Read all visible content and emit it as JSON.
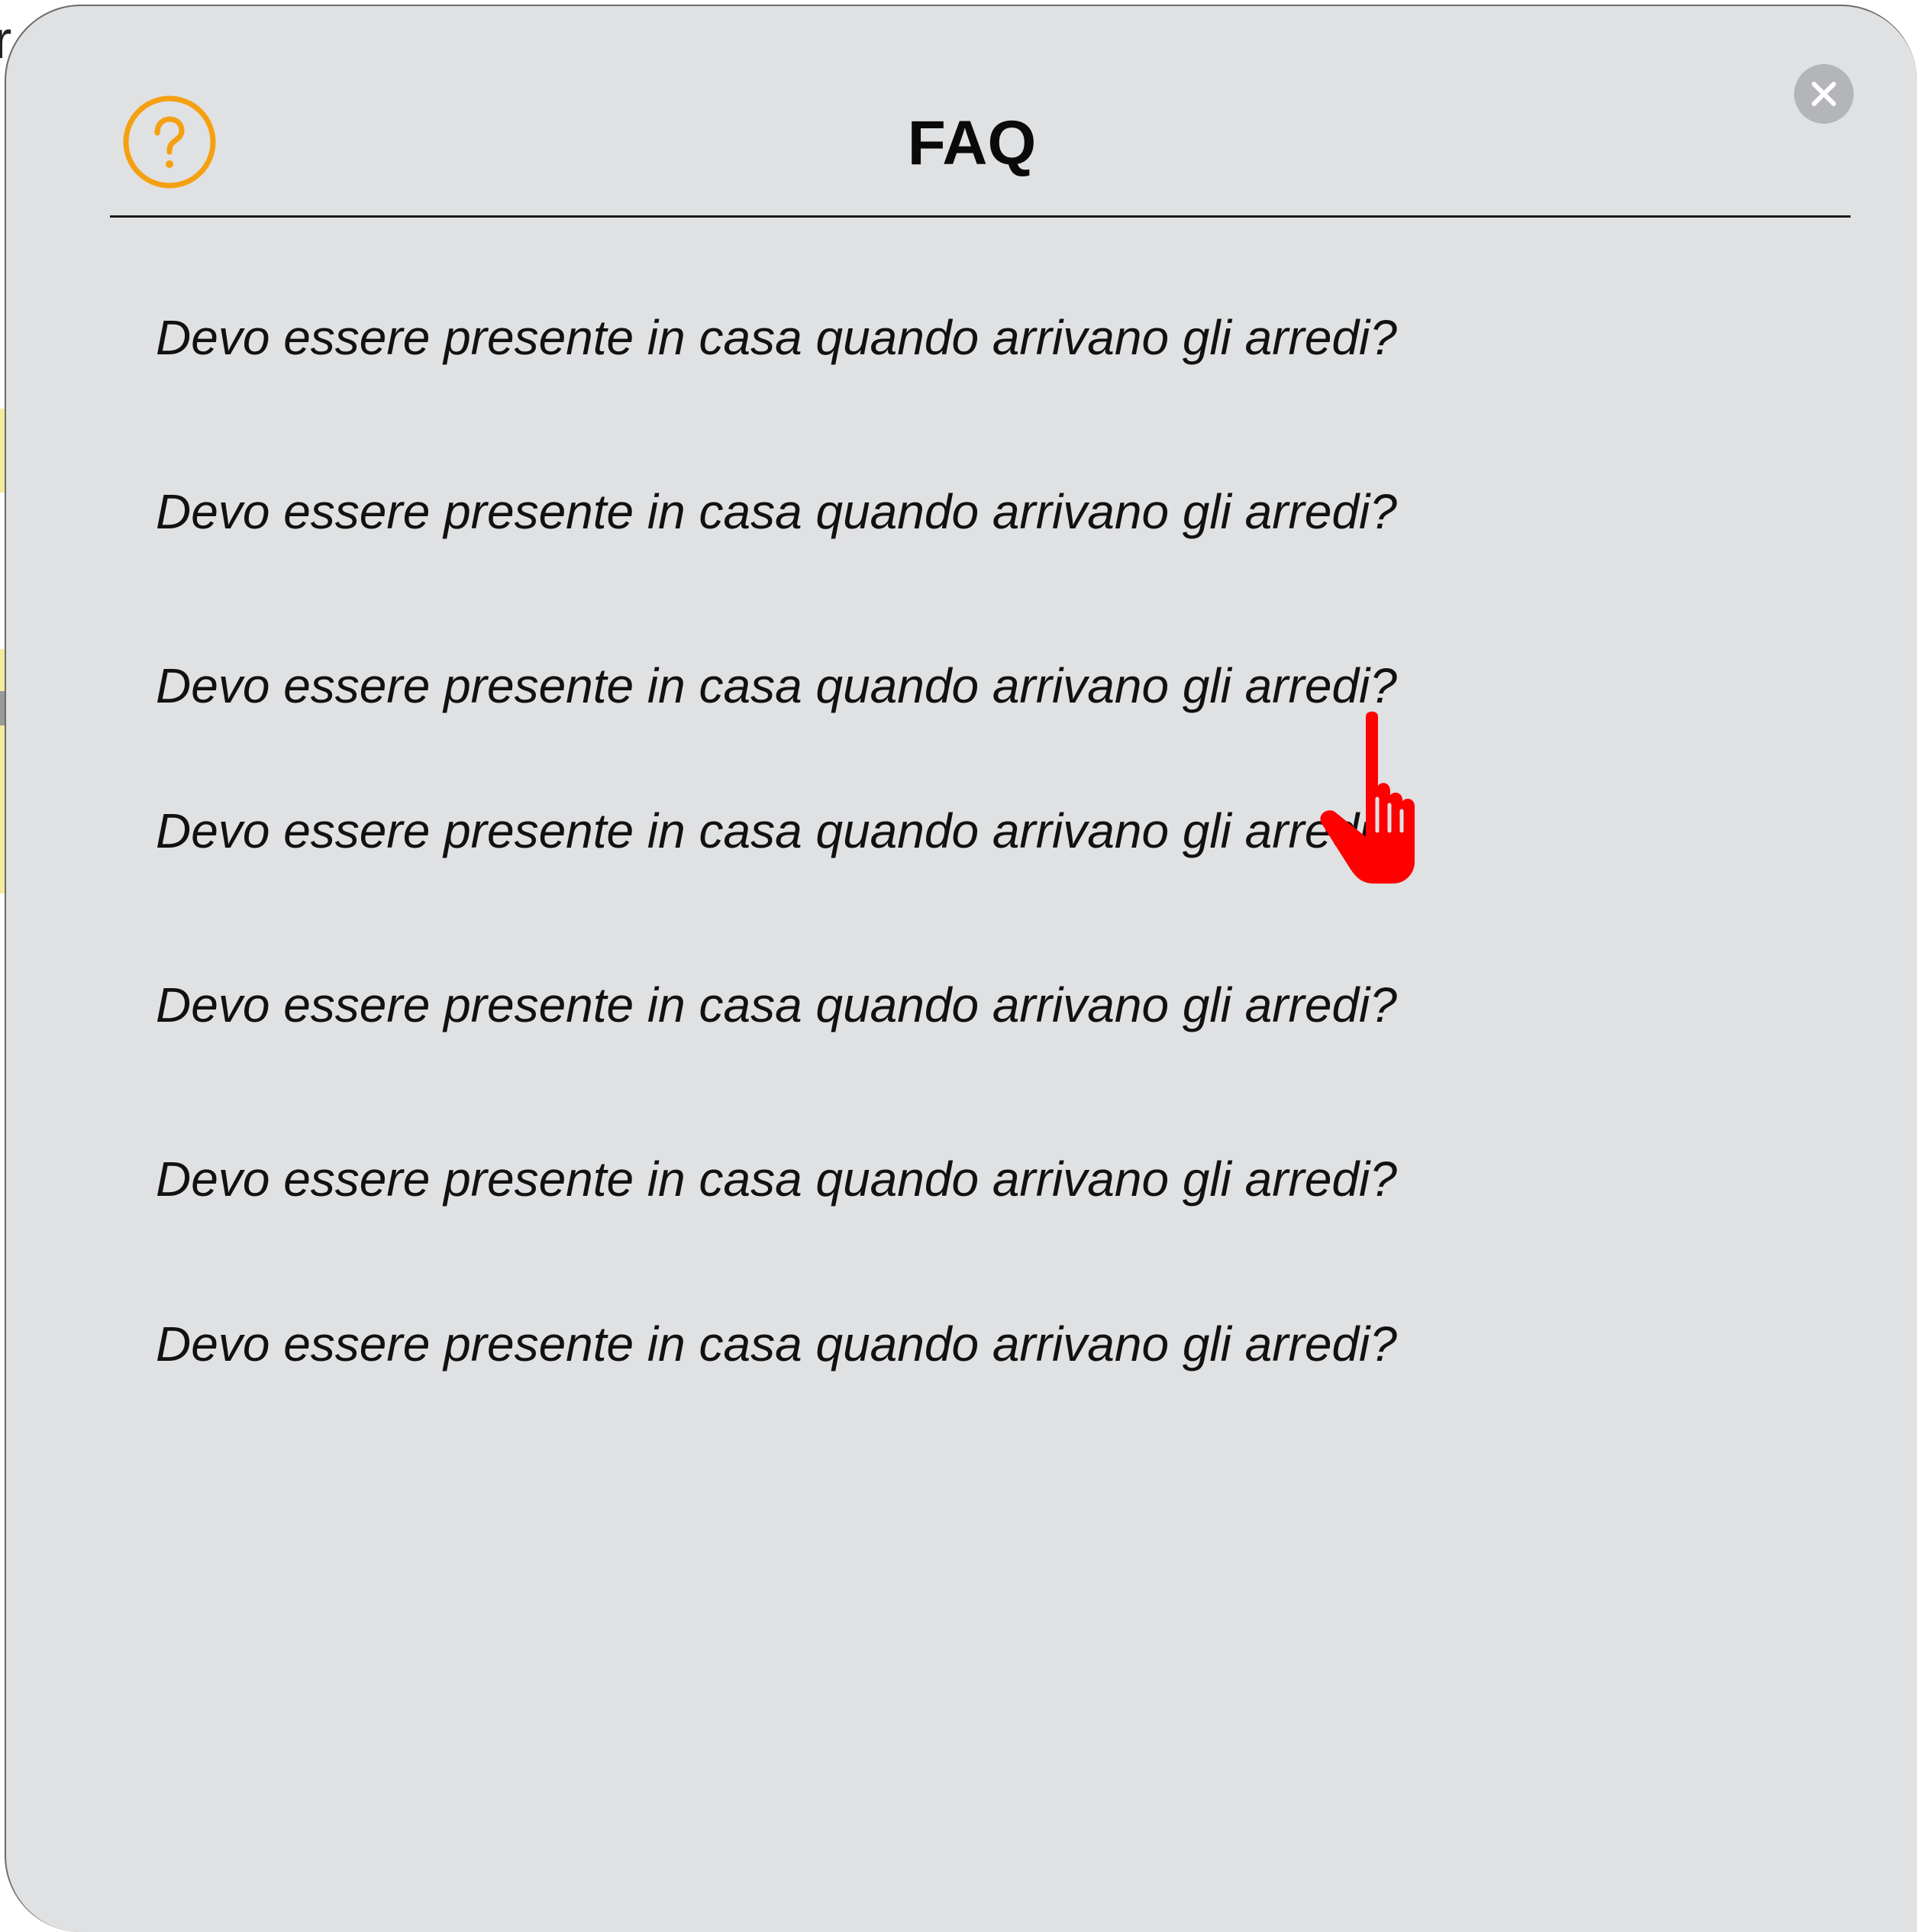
{
  "modal": {
    "title": "FAQ",
    "help_icon": "question-circle-icon",
    "close_icon": "close-icon",
    "accent_color": "#f5a011",
    "background_color": "#e0e1e3"
  },
  "faq": {
    "items": [
      {
        "question": "Devo essere presente in casa quando arrivano gli arredi?"
      },
      {
        "question": "Devo essere presente in casa quando arrivano gli arredi?"
      },
      {
        "question": "Devo essere presente in casa quando arrivano gli arredi?"
      },
      {
        "question": "Devo essere presente in casa quando arrivano gli arredi?"
      },
      {
        "question": "Devo essere presente in casa quando arrivano gli arredi?"
      },
      {
        "question": "Devo essere presente in casa quando arrivano gli arredi?"
      },
      {
        "question": "Devo essere presente in casa quando arrivano gli arredi?"
      }
    ]
  },
  "cursor": {
    "icon": "hand-pointer-icon",
    "color": "#ff0000"
  }
}
